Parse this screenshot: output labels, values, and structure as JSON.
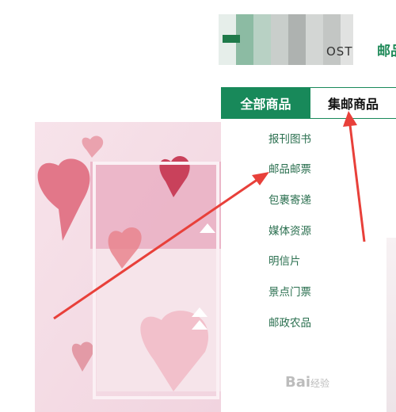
{
  "header": {
    "logo_text": "OST",
    "top_link": "邮品"
  },
  "tabs": {
    "all": "全部商品",
    "stamp": "集邮商品"
  },
  "menu": {
    "items": [
      {
        "label": "报刊图书"
      },
      {
        "label": "邮品邮票"
      },
      {
        "label": "包裹寄递"
      },
      {
        "label": "媒体资源"
      },
      {
        "label": "明信片"
      },
      {
        "label": "景点门票"
      },
      {
        "label": "邮政农品"
      }
    ],
    "chevron_icon": "chevron-right-icon"
  },
  "annotations": {
    "arrow_color": "#e8403a",
    "arrow_icon": "arrow-icon"
  },
  "watermark": {
    "text": "Bai",
    "suffix": "经验"
  },
  "colors": {
    "brand_green": "#18895a",
    "link_green": "#2a6f4f"
  }
}
